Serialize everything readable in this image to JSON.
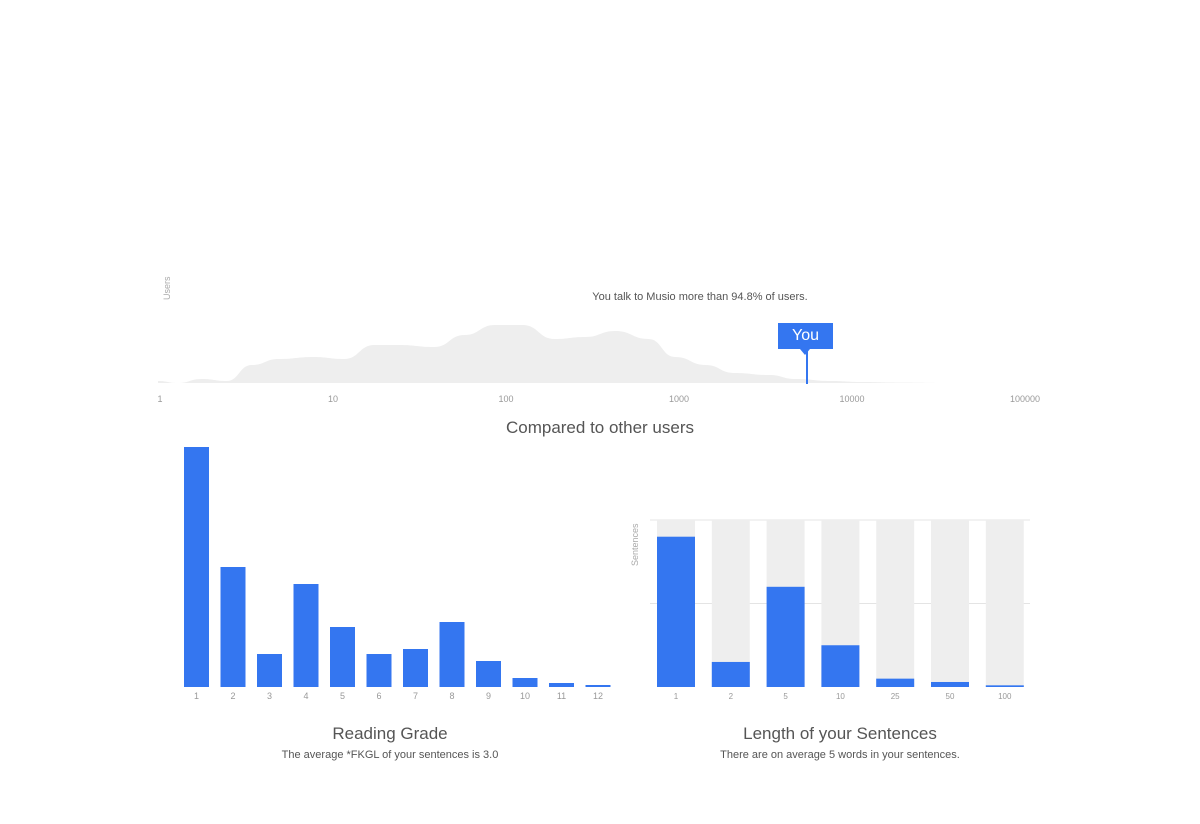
{
  "colors": {
    "accent": "#3476f0",
    "area": "#eeeeee",
    "track": "#eeeeee",
    "text": "#555555",
    "axis": "#999999"
  },
  "distribution": {
    "headline": "You talk to Musio more than 94.8% of users.",
    "ylabel": "Users",
    "you_label": "You",
    "x_ticks": [
      "1",
      "10",
      "100",
      "1000",
      "10000",
      "100000"
    ]
  },
  "section_title": "Compared to other users",
  "chart_data": [
    {
      "type": "area",
      "ylabel": "Users",
      "xscale": "log",
      "xlim": [
        1,
        100000
      ],
      "x": [
        1,
        1.3,
        1.8,
        2.5,
        3.5,
        5,
        8,
        12,
        18,
        25,
        40,
        60,
        90,
        130,
        200,
        300,
        450,
        700,
        1000,
        1500,
        2200,
        3500,
        5000,
        8000,
        12000,
        20000,
        40000,
        100000
      ],
      "values": [
        1,
        0,
        2,
        1,
        9,
        12,
        13,
        12,
        19,
        19,
        18,
        24,
        29,
        29,
        22,
        23,
        26,
        22,
        13,
        9,
        5,
        4,
        2,
        1,
        0.5,
        0.2,
        0,
        0
      ],
      "marker": {
        "label": "You",
        "x": 5500
      }
    },
    {
      "type": "bar",
      "title": "Reading Grade",
      "subtitle": "The average *FKGL of your sentences is 3.0",
      "categories": [
        "1",
        "2",
        "3",
        "4",
        "5",
        "6",
        "7",
        "8",
        "9",
        "10",
        "11",
        "12"
      ],
      "values": [
        240,
        120,
        33,
        103,
        60,
        33,
        38,
        65,
        26,
        9,
        4,
        2
      ],
      "ylim": [
        0,
        240
      ],
      "grid": false
    },
    {
      "type": "bar",
      "title": "Length of your Sentences",
      "subtitle": "There are on average 5 words in your sentences.",
      "ylabel": "Sentences",
      "categories": [
        "1",
        "2",
        "5",
        "10",
        "25",
        "50",
        "100"
      ],
      "values": [
        90,
        15,
        60,
        25,
        5,
        3,
        1
      ],
      "ylim": [
        0,
        100
      ],
      "grid": true
    }
  ]
}
